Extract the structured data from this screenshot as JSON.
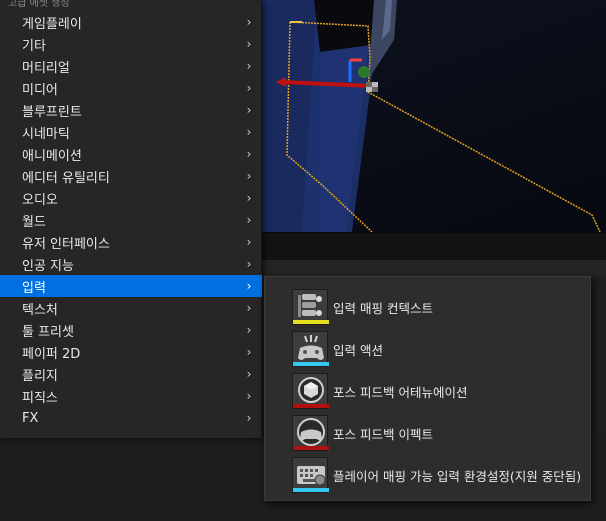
{
  "main_menu": {
    "header": "고급 에셋 생성",
    "items": [
      {
        "label": "게임플레이"
      },
      {
        "label": "기타"
      },
      {
        "label": "머티리얼"
      },
      {
        "label": "미디어"
      },
      {
        "label": "블루프린트"
      },
      {
        "label": "시네마틱"
      },
      {
        "label": "애니메이션"
      },
      {
        "label": "에디터 유틸리티"
      },
      {
        "label": "오디오"
      },
      {
        "label": "월드"
      },
      {
        "label": "유저 인터페이스"
      },
      {
        "label": "인공 지능"
      },
      {
        "label": "입력"
      },
      {
        "label": "텍스처"
      },
      {
        "label": "툴 프리셋"
      },
      {
        "label": "페이퍼 2D"
      },
      {
        "label": "플리지"
      },
      {
        "label": "피직스"
      },
      {
        "label": "FX"
      }
    ],
    "active_index": 12,
    "arrow_glyph": "›"
  },
  "submenu": {
    "items": [
      {
        "label": "입력 매핑 컨텍스트",
        "icon": "mapping-context-icon",
        "accent": "#e6e01e"
      },
      {
        "label": "입력 액션",
        "icon": "gamepad-action-icon",
        "accent": "#35c8f0"
      },
      {
        "label": "포스 피드백 어테뉴에이션",
        "icon": "force-feedback-attenuation-icon",
        "accent": "#b01010"
      },
      {
        "label": "포스 피드백 이펙트",
        "icon": "force-feedback-effect-icon",
        "accent": "#b01010"
      },
      {
        "label": "플레이어 매핑 가능 입력 환경설정(지원 중단됨)",
        "icon": "keyboard-settings-icon",
        "accent": "#35c8f0"
      }
    ]
  },
  "colors": {
    "menu_bg": "#262626",
    "active_bg": "#0070e0",
    "submenu_bg": "#2d2d2d",
    "selection_outline": "#e0a020"
  }
}
